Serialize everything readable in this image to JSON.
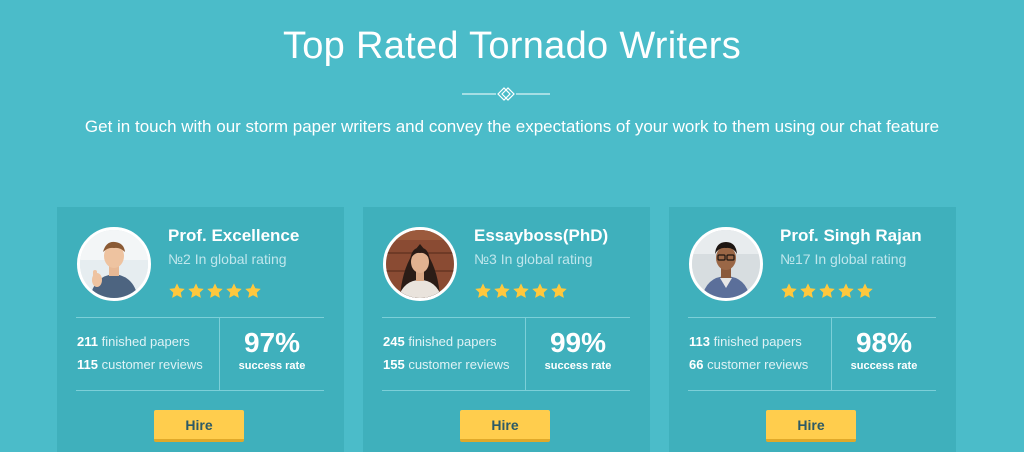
{
  "header": {
    "title": "Top Rated Tornado Writers",
    "subtitle": "Get in touch with our storm paper writers and convey the expectations of your work to them using our chat feature"
  },
  "colors": {
    "background": "#4bbcc9",
    "card": "#3fb0bc",
    "button": "#ffcd4d",
    "star": "#ffc83d"
  },
  "writers": [
    {
      "name": "Prof. Excellence",
      "rank": "№2 In global rating",
      "stars": 5,
      "finished_count": "211",
      "finished_label": "finished papers",
      "reviews_count": "115",
      "reviews_label": "customer reviews",
      "success_rate": "97%",
      "success_label": "success rate",
      "hire_label": "Hire"
    },
    {
      "name": "Essayboss(PhD)",
      "rank": "№3 In global rating",
      "stars": 5,
      "finished_count": "245",
      "finished_label": "finished papers",
      "reviews_count": "155",
      "reviews_label": "customer reviews",
      "success_rate": "99%",
      "success_label": "success rate",
      "hire_label": "Hire"
    },
    {
      "name": "Prof. Singh Rajan",
      "rank": "№17 In global rating",
      "stars": 5,
      "finished_count": "113",
      "finished_label": "finished papers",
      "reviews_count": "66",
      "reviews_label": "customer reviews",
      "success_rate": "98%",
      "success_label": "success rate",
      "hire_label": "Hire"
    }
  ]
}
